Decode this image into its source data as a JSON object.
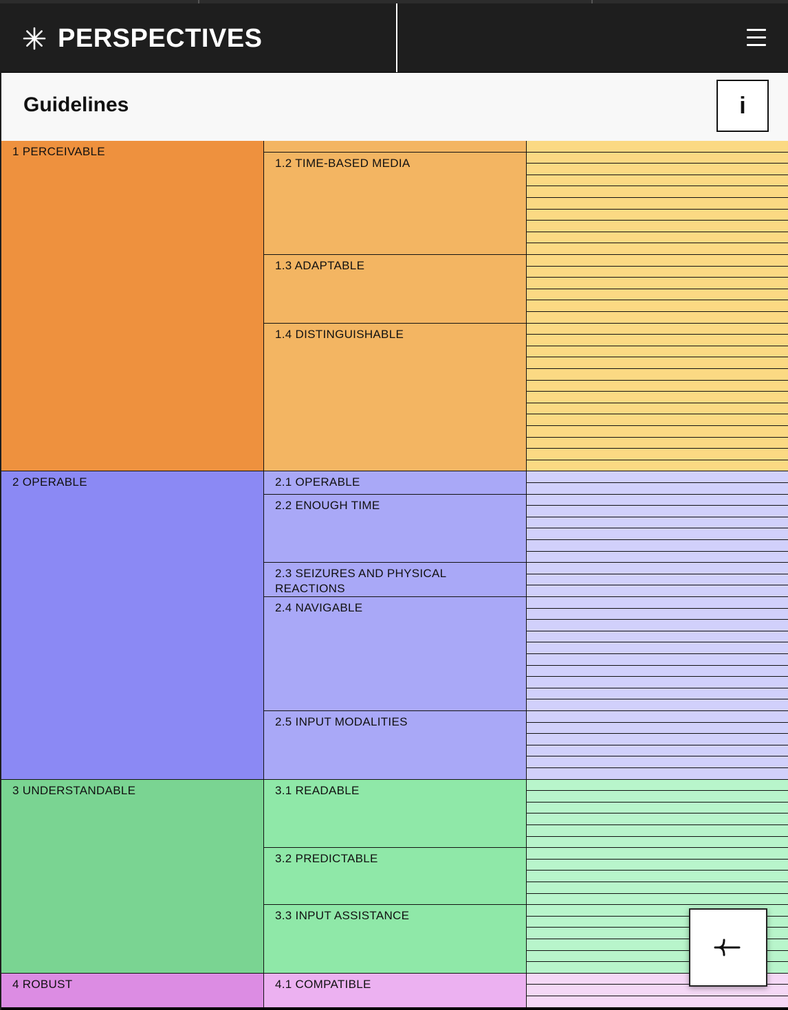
{
  "header": {
    "app_title": "PERSPECTIVES",
    "logo_icon": "asterisk-icon",
    "menu_icon": "hamburger-menu-icon"
  },
  "subheader": {
    "title": "Guidelines",
    "info_label": "i"
  },
  "fab": {
    "icon": "merge-arrow-left-icon"
  },
  "colors": {
    "header_bg": "#1e1e1e",
    "subheader_bg": "#f8f8f8",
    "perceivable": [
      "#ee913e",
      "#f3b562",
      "#fbd983"
    ],
    "operable": [
      "#8b89f4",
      "#a9a8f7",
      "#d1d0fb"
    ],
    "understandable": [
      "#7ad492",
      "#8fe8a8",
      "#b8f5cb"
    ],
    "robust": [
      "#dc8ce3",
      "#ecb1f1",
      "#f5d8f6"
    ]
  },
  "principles": [
    {
      "label": "1 PERCEIVABLE",
      "theme": "perceivable",
      "guidelines": [
        {
          "label": "",
          "criteria": 1
        },
        {
          "label": "1.2 TIME-BASED MEDIA",
          "criteria": 9
        },
        {
          "label": "1.3 ADAPTABLE",
          "criteria": 6
        },
        {
          "label": "1.4 DISTINGUISHABLE",
          "criteria": 13
        }
      ]
    },
    {
      "label": "2 OPERABLE",
      "theme": "operable",
      "guidelines": [
        {
          "label": "2.1 OPERABLE",
          "criteria": 2
        },
        {
          "label": "2.2 ENOUGH TIME",
          "criteria": 6
        },
        {
          "label": "2.3 SEIZURES AND PHYSICAL REACTIONS",
          "criteria": 3
        },
        {
          "label": "2.4 NAVIGABLE",
          "criteria": 10
        },
        {
          "label": "2.5 INPUT MODALITIES",
          "criteria": 6
        }
      ]
    },
    {
      "label": "3 UNDERSTANDABLE",
      "theme": "understandable",
      "guidelines": [
        {
          "label": "3.1 READABLE",
          "criteria": 6
        },
        {
          "label": "3.2 PREDICTABLE",
          "criteria": 5
        },
        {
          "label": "3.3 INPUT ASSISTANCE",
          "criteria": 6
        }
      ]
    },
    {
      "label": "4 ROBUST",
      "theme": "robust",
      "guidelines": [
        {
          "label": "4.1 COMPATIBLE",
          "criteria": 3
        }
      ]
    }
  ]
}
